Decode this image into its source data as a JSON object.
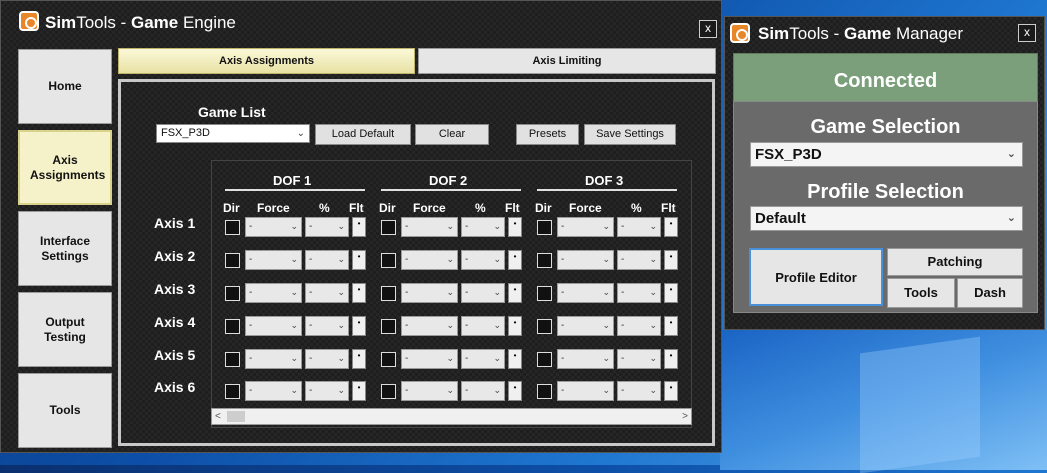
{
  "engine": {
    "title_prefix": "Sim",
    "title_mid": "Tools - ",
    "title_bold": "Game",
    "title_suffix": " Engine",
    "close": "x",
    "nav": [
      {
        "label": "Home"
      },
      {
        "label": "Axis Assignments"
      },
      {
        "label": "Interface Settings"
      },
      {
        "label": "Output Testing"
      },
      {
        "label": "Tools"
      }
    ],
    "tabs": [
      {
        "label": "Axis Assignments"
      },
      {
        "label": "Axis Limiting"
      }
    ],
    "game_list_label": "Game List",
    "game_list_value": "FSX_P3D",
    "buttons": {
      "load_default": "Load Default",
      "clear": "Clear",
      "presets": "Presets",
      "save_settings": "Save Settings"
    },
    "dofs": [
      "DOF 1",
      "DOF 2",
      "DOF 3"
    ],
    "columns": {
      "dir": "Dir",
      "force": "Force",
      "pct": "%",
      "flt": "Flt"
    },
    "axes": [
      "Axis 1",
      "Axis 2",
      "Axis 3",
      "Axis 4",
      "Axis 5",
      "Axis 6"
    ],
    "cell_force_value": "-",
    "cell_pct_value": "-",
    "flt_glyph": "•"
  },
  "manager": {
    "title_prefix": "Sim",
    "title_mid": "Tools - ",
    "title_bold": "Game",
    "title_suffix": " Manager",
    "close": "x",
    "status": "Connected",
    "status_color": "#7a9f7a",
    "game_selection_label": "Game Selection",
    "game_selection_value": "FSX_P3D",
    "profile_selection_label": "Profile Selection",
    "profile_selection_value": "Default",
    "buttons": {
      "profile_editor": "Profile Editor",
      "patching": "Patching",
      "tools": "Tools",
      "dash": "Dash"
    }
  },
  "icons": {
    "chevron": "⌄",
    "scroll_left": "<",
    "scroll_right": ">"
  }
}
